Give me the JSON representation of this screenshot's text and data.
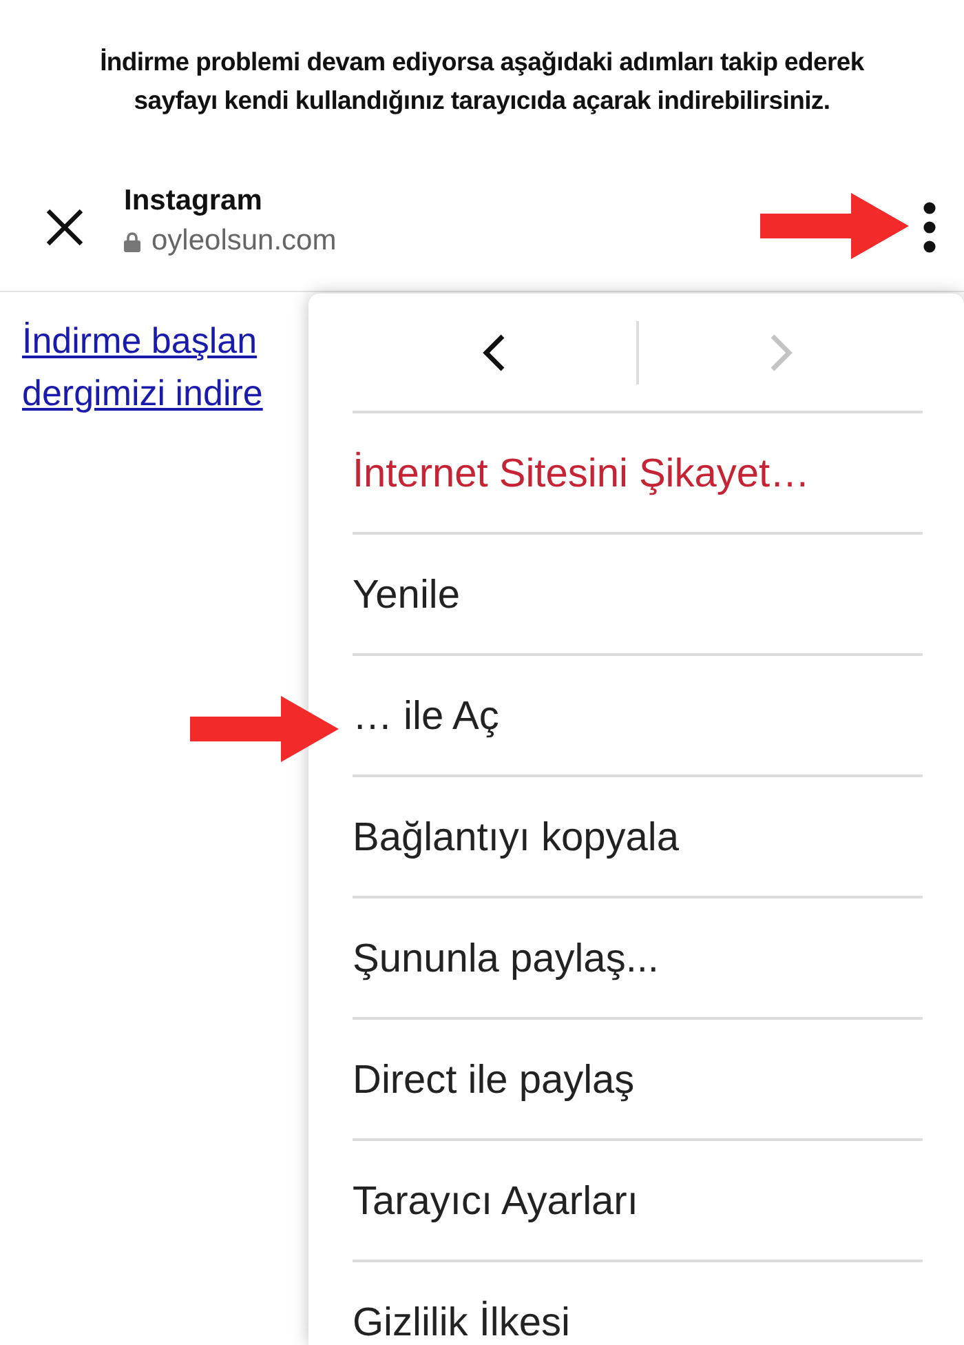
{
  "instruction": [
    "İndirme problemi devam ediyorsa aşağıdaki adımları takip ederek",
    "sayfayı kendi kullandığınız tarayıcıda açarak indirebilirsiniz."
  ],
  "header": {
    "title": "Instagram",
    "url": "oyleolsun.com"
  },
  "page_link": [
    "İndirme başlan",
    "dergimizi indire"
  ],
  "menu": {
    "nav": [
      {
        "kind": "back",
        "disabled": false
      },
      {
        "kind": "forward",
        "disabled": true
      }
    ],
    "items": [
      {
        "label": "İnternet Sitesini Şikayet…",
        "kind": "danger"
      },
      {
        "label": "Yenile",
        "kind": "normal"
      },
      {
        "label": "… ile Aç",
        "kind": "normal"
      },
      {
        "label": "Bağlantıyı kopyala",
        "kind": "normal"
      },
      {
        "label": "Şununla paylaş...",
        "kind": "normal"
      },
      {
        "label": "Direct ile paylaş",
        "kind": "normal"
      },
      {
        "label": "Tarayıcı Ayarları",
        "kind": "normal"
      },
      {
        "label": "Gizlilik İlkesi",
        "kind": "normal"
      }
    ]
  }
}
